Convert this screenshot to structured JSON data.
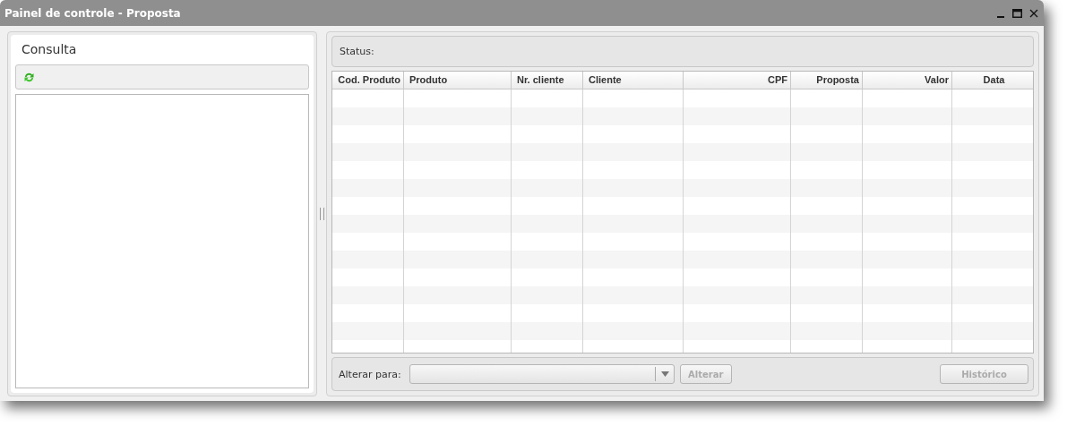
{
  "window": {
    "title": "Painel de controle - Proposta"
  },
  "consulta": {
    "title": "Consulta"
  },
  "status": {
    "label": "Status:"
  },
  "table": {
    "columns": [
      {
        "label": "Cod. Produto"
      },
      {
        "label": "Produto"
      },
      {
        "label": "Nr. cliente"
      },
      {
        "label": "Cliente"
      },
      {
        "label": "CPF"
      },
      {
        "label": "Proposta"
      },
      {
        "label": "Valor"
      },
      {
        "label": "Data"
      }
    ]
  },
  "footer": {
    "label": "Alterar para:",
    "apply_button": {
      "label": "Alterar",
      "disabled": true
    },
    "history_button": {
      "label": "Histórico",
      "disabled": true
    }
  }
}
